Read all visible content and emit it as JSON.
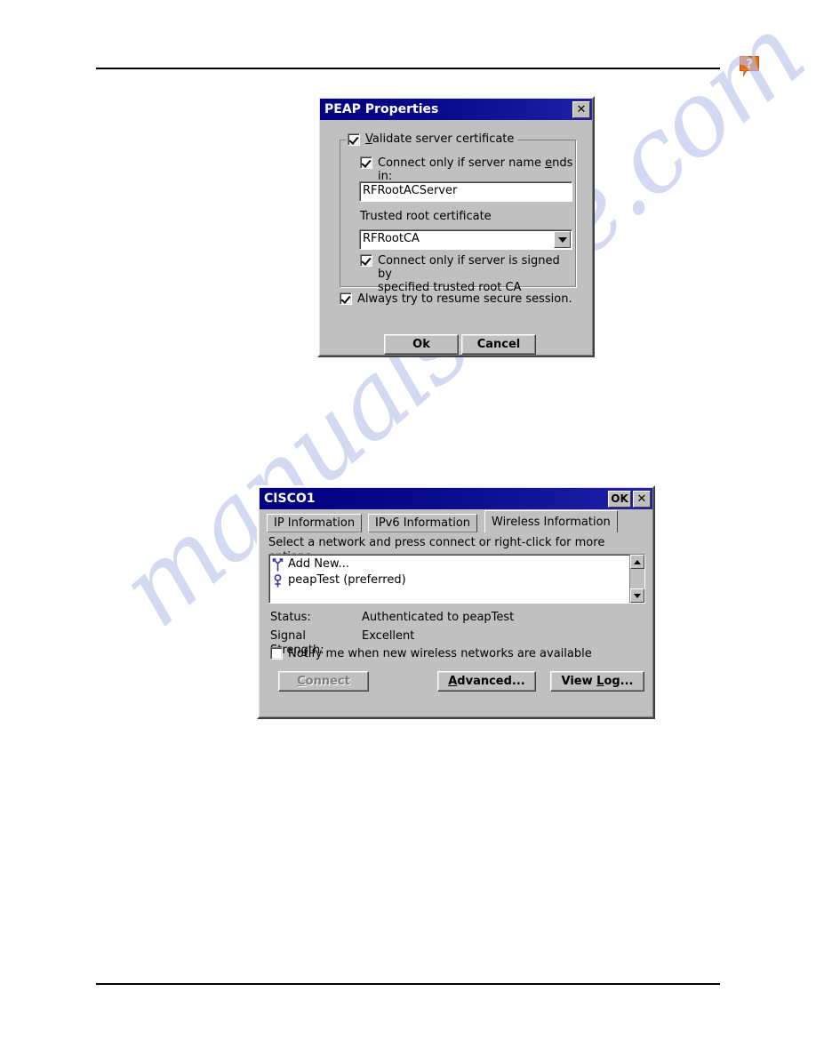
{
  "page": {
    "help_icon": "help-question-bubble-icon",
    "watermark_text": "manualshive.com",
    "accent_title_color": "#000080",
    "dialog_face_color": "#c0c0c0",
    "watermark_color": "#b9c2e8",
    "help_icon_color": "#e2661a"
  },
  "peap_dialog": {
    "title": "PEAP Properties",
    "close_label": "✕",
    "validate_group": {
      "checkbox_label_pre": "",
      "checkbox_label_acc": "V",
      "checkbox_label_post": "alidate server certificate",
      "checked": true,
      "server_name_check": {
        "label_pre": "Connect only if server name ",
        "label_acc": "e",
        "label_post": "nds in:",
        "checked": true
      },
      "server_name_value": "RFRootACServer",
      "trusted_root_label": "Trusted root certificate",
      "trusted_root_value": "RFRootCA",
      "signed_by_check": {
        "line1": "Connect only if server is signed by",
        "line2": "specified trusted root CA",
        "checked": true
      }
    },
    "resume_check": {
      "label": "Always try to resume secure session.",
      "checked": true
    },
    "buttons": {
      "ok": "Ok",
      "cancel": "Cancel"
    }
  },
  "cisco_dialog": {
    "title": "CISCO1",
    "ok_label": "OK",
    "close_label": "✕",
    "tabs": [
      {
        "label": "IP Information",
        "active": false
      },
      {
        "label": "IPv6 Information",
        "active": false
      },
      {
        "label": "Wireless Information",
        "active": true
      }
    ],
    "instruction": "Select a network and press connect or right-click for more options.",
    "network_list": [
      {
        "label": "Add New...",
        "icon": "antenna-add-icon"
      },
      {
        "label": "peapTest (preferred)",
        "icon": "antenna-preferred-icon"
      }
    ],
    "status": {
      "status_label": "Status:",
      "status_value": "Authenticated to peapTest",
      "signal_label": "Signal Strength:",
      "signal_value": "Excellent"
    },
    "notify_check": {
      "label": "Notify me when new wireless networks are available",
      "checked": false
    },
    "buttons": {
      "connect_pre": "",
      "connect_acc": "C",
      "connect_post": "onnect",
      "connect_disabled": true,
      "advanced_acc": "A",
      "advanced_post": "dvanced...",
      "viewlog_pre": "View ",
      "viewlog_acc": "L",
      "viewlog_post": "og..."
    }
  }
}
